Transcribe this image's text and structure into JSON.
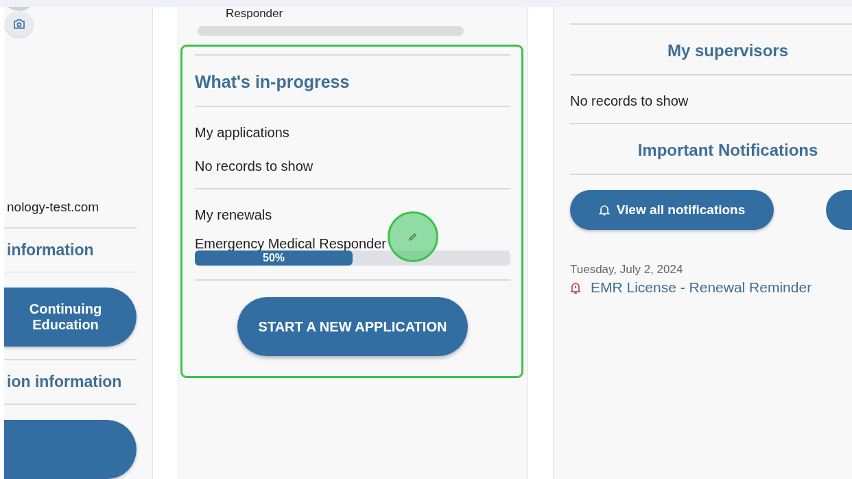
{
  "left_panel": {
    "email_fragment": "nology-test.com",
    "sections": [
      {
        "heading": "information",
        "button": "Continuing Education"
      },
      {
        "heading": "ion information"
      }
    ]
  },
  "middle_panel": {
    "top_item": "Responder",
    "in_progress": {
      "title": "What's in-progress",
      "applications": {
        "label": "My applications",
        "empty": "No records to show"
      },
      "renewals": {
        "label": "My renewals",
        "items": [
          {
            "name": "Emergency Medical Responder",
            "level": 0.5,
            "reading": "50%"
          }
        ]
      },
      "button": "START A NEW APPLICATION"
    }
  },
  "right_panel": {
    "supervisors": {
      "title": "My supervisors",
      "empty": "No records to show"
    },
    "notifications": {
      "title": "Important Notifications",
      "button": "View all notifications",
      "items": [
        {
          "date": "Tuesday, July 2, 2024",
          "title": "EMR License - Renewal Reminder"
        }
      ]
    }
  }
}
